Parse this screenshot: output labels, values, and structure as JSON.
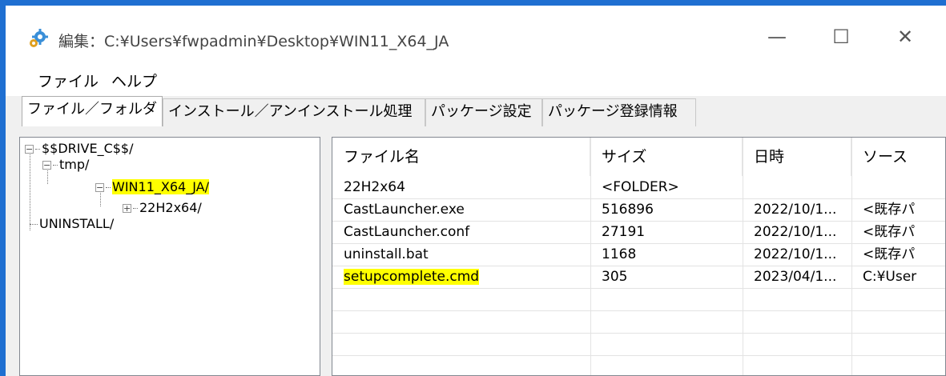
{
  "window": {
    "title": "編集：C:¥Users¥fwpadmin¥Desktop¥WIN11_X64_JA",
    "icon": "gear-icon",
    "controls": {
      "minimize": "—",
      "maximize": "☐",
      "close": "✕"
    },
    "accent_color": "#1f6fd1"
  },
  "menu": {
    "file": "ファイル",
    "help": "ヘルプ"
  },
  "tabs": [
    {
      "label": "ファイル／フォルダ",
      "active": true
    },
    {
      "label": "インストール／アンインストール処理",
      "active": false
    },
    {
      "label": "パッケージ設定",
      "active": false
    },
    {
      "label": "パッケージ登録情報",
      "active": false
    }
  ],
  "tree": {
    "nodes": [
      {
        "label": "$$DRIVE_C$$/",
        "expander": "−"
      },
      {
        "label": "tmp/",
        "expander": "−"
      },
      {
        "label": "WIN11_X64_JA/",
        "expander": "−",
        "highlighted": true
      },
      {
        "label": "22H2x64/",
        "expander": "+"
      },
      {
        "label": "UNINSTALL/",
        "expander": ""
      }
    ]
  },
  "list": {
    "columns": [
      "ファイル名",
      "サイズ",
      "日時",
      "ソース"
    ],
    "rows": [
      {
        "name": "22H2x64",
        "size": "<FOLDER>",
        "date": "",
        "source": ""
      },
      {
        "name": "CastLauncher.exe",
        "size": "516896",
        "date": "2022/10/1...",
        "source": "<既存パ"
      },
      {
        "name": "CastLauncher.conf",
        "size": "27191",
        "date": "2022/10/1...",
        "source": "<既存パ"
      },
      {
        "name": "uninstall.bat",
        "size": "1168",
        "date": "2022/10/1...",
        "source": "<既存パ"
      },
      {
        "name": "setupcomplete.cmd",
        "size": "305",
        "date": "2023/04/1...",
        "source": "C:¥User",
        "highlighted": true
      }
    ],
    "highlight_color": "#ffff00"
  }
}
